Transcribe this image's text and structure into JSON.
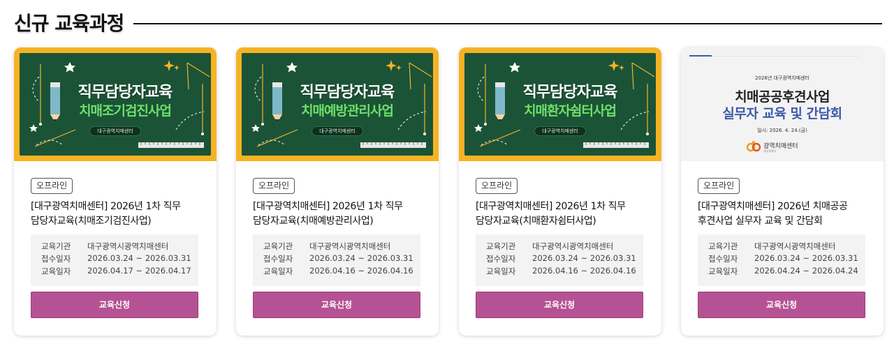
{
  "section": {
    "title": "신규 교육과정"
  },
  "cards": [
    {
      "thumb": {
        "title": "직무담당자교육",
        "subtitle": "치매조기검진사업",
        "pill": "대구광역치매센터"
      },
      "badge": "오프라인",
      "title_line1": "[대구광역치매센터] 2026년 1차 직무",
      "title_line2": "담당자교육(치매조기검진사업)",
      "info": [
        {
          "label": "교육기관",
          "value": "대구광역시광역치매센터"
        },
        {
          "label": "접수일자",
          "value": "2026.03.24 ~ 2026.03.31"
        },
        {
          "label": "교육일자",
          "value": "2026.04.17 ~ 2026.04.17"
        }
      ],
      "apply_label": "교육신청"
    },
    {
      "thumb": {
        "title": "직무담당자교육",
        "subtitle": "치매예방관리사업",
        "pill": "대구광역치매센터"
      },
      "badge": "오프라인",
      "title_line1": "[대구광역치매센터] 2026년 1차 직무",
      "title_line2": "담당자교육(치매예방관리사업)",
      "info": [
        {
          "label": "교육기관",
          "value": "대구광역시광역치매센터"
        },
        {
          "label": "접수일자",
          "value": "2026.03.24 ~ 2026.03.31"
        },
        {
          "label": "교육일자",
          "value": "2026.04.16 ~ 2026.04.16"
        }
      ],
      "apply_label": "교육신청"
    },
    {
      "thumb": {
        "title": "직무담당자교육",
        "subtitle": "치매환자쉼터사업",
        "pill": "대구광역치매센터"
      },
      "badge": "오프라인",
      "title_line1": "[대구광역치매센터] 2026년 1차 직무",
      "title_line2": "담당자교육(치매환자쉼터사업)",
      "info": [
        {
          "label": "교육기관",
          "value": "대구광역시광역치매센터"
        },
        {
          "label": "접수일자",
          "value": "2026.03.24 ~ 2026.03.31"
        },
        {
          "label": "교육일자",
          "value": "2026.04.16 ~ 2026.04.16"
        }
      ],
      "apply_label": "교육신청"
    },
    {
      "poster": {
        "small": "2026년 대구광역치매센터",
        "title1": "치매공공후견사업",
        "title2": "실무자 교육 및 간담회",
        "date": "일시: 2026. 4. 24.(금)",
        "logo_text": "광역치매센터",
        "logo_sub": "대구광역시"
      },
      "badge": "오프라인",
      "title_line1": "[대구광역치매센터] 2026년 치매공공",
      "title_line2": "후견사업 실무자 교육 및 간담회",
      "info": [
        {
          "label": "교육기관",
          "value": "대구광역시광역치매센터"
        },
        {
          "label": "접수일자",
          "value": "2026.03.24 ~ 2026.03.31"
        },
        {
          "label": "교육일자",
          "value": "2026.04.24 ~ 2026.04.24"
        }
      ],
      "apply_label": "교육신청"
    }
  ],
  "colors": {
    "apply_button": "#b55293",
    "chalkboard": "#1b5337",
    "board_frame": "#f5b324",
    "poster_accent": "#3e5aa8"
  },
  "icons": [
    "star-icon",
    "sparkle-icon",
    "pencil-icon",
    "ruler-icon",
    "logo-icon"
  ]
}
